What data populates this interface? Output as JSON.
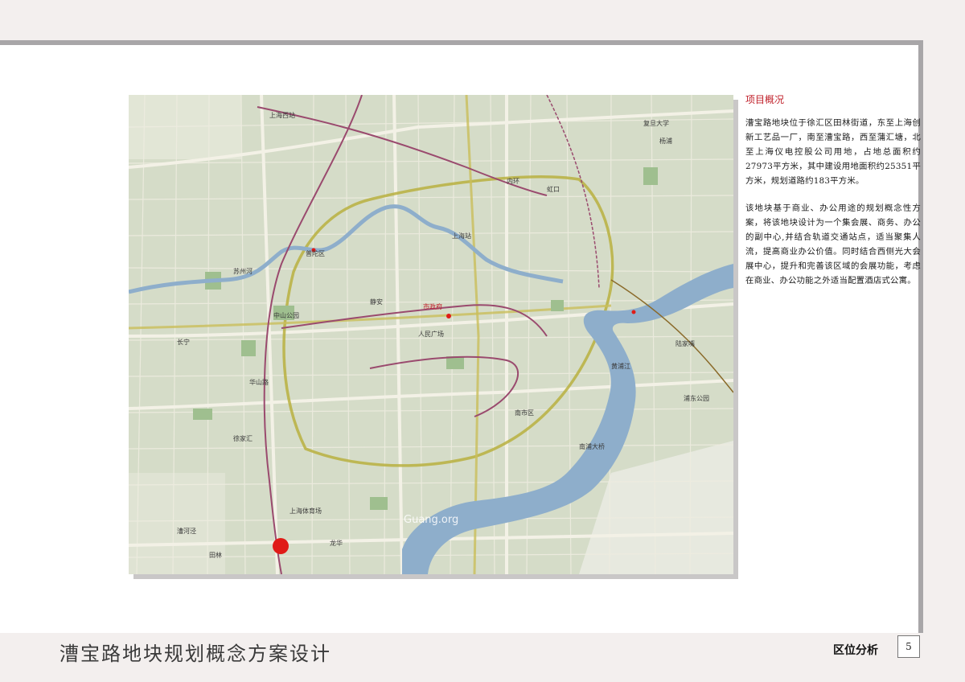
{
  "document": {
    "title": "漕宝路地块规划概念方案设计",
    "section": "区位分析",
    "page_number": "5"
  },
  "overview": {
    "heading": "项目概况",
    "paragraphs": [
      "漕宝路地块位于徐汇区田林街道，东至上海创新工艺品一厂，南至漕宝路，西至蒲汇塘，北至上海仪电控股公司用地，占地总面积约27973平方米，其中建设用地面积约25351平方米，规划道路约183平方米。",
      "该地块基于商业、办公用途的规划概念性方案，将该地块设计为一个集会展、商务、办公的副中心,并结合轨道交通站点，适当聚集人流，提高商业办公价值。同时结合西侧光大会展中心，提升和完善该区域的会展功能，考虑在商业、办公功能之外适当配置酒店式公寓。"
    ]
  },
  "map": {
    "watermark": "Guang.org",
    "labels": {
      "shanghai_west_station": "上海西站",
      "shanghai_station": "上海站",
      "zhongshan_park": "中山公园",
      "jingan": "静安",
      "people_square": "人民广场",
      "city_government": "市政府",
      "xujiahui": "徐家汇",
      "huangpu_river": "黄浦江",
      "lujiazui": "陆家嘴",
      "nanpu_bridge": "南浦大桥",
      "longhua": "龙华",
      "caohejing": "漕河泾",
      "tianlin": "田林",
      "changning": "长宁",
      "putuo": "普陀区",
      "hongkou": "虹口",
      "yangpu": "杨浦",
      "nanshi": "南市区",
      "shanghai_stadium": "上海体育场",
      "pudong_park": "浦东公园",
      "suzhou_creek": "苏州河",
      "inner_ring": "内环",
      "huashan_rd": "华山路",
      "fudan": "复旦大学"
    },
    "colors": {
      "land": "#d5dcc8",
      "water": "#8eaecb",
      "park": "#9fbf8f",
      "road": "#f3f1e6",
      "rail": "#9a4a6e",
      "highway": "#b8b040",
      "site_marker": "#e01b17"
    }
  }
}
